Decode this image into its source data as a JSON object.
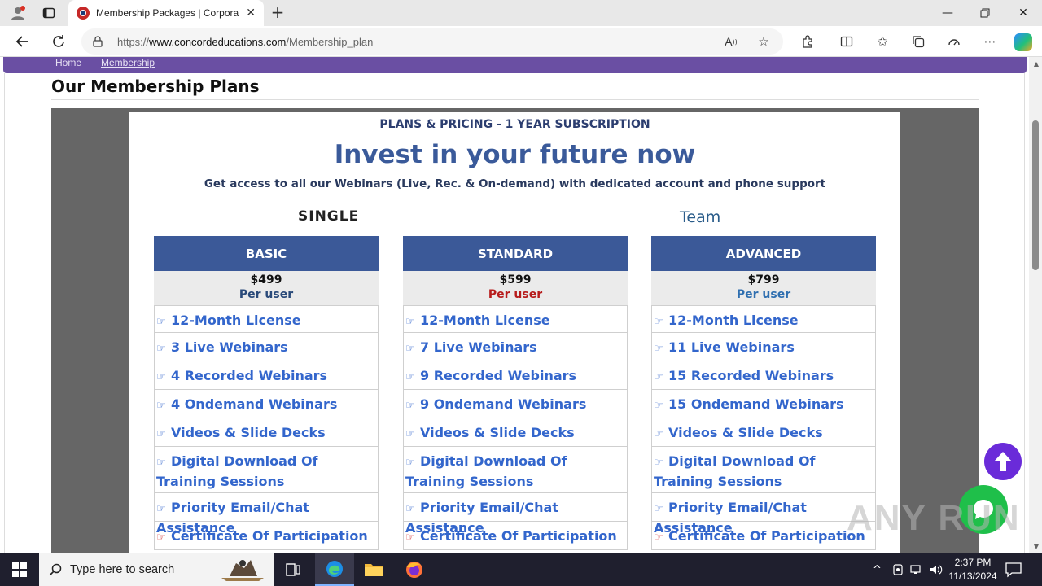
{
  "browser": {
    "tab_title": "Membership Packages | Corporat",
    "url_prefix": "https://",
    "url_domain": "www.concordeducations.com",
    "url_path": "/Membership_plan"
  },
  "breadcrumb": {
    "home": "Home",
    "current": "Membership"
  },
  "page": {
    "heading": "Our Membership Plans",
    "kicker": "PLANS & PRICING - 1 YEAR SUBSCRIPTION",
    "title": "Invest in your future now",
    "subtitle": "Get access to all our Webinars (Live, Rec. & On-demand) with dedicated account and phone support",
    "group_single": "SINGLE",
    "group_team": "Team"
  },
  "plans": [
    {
      "name": "BASIC",
      "price": "$499",
      "per": "Per user",
      "per_color": "#2a4a7a",
      "features": [
        "12-Month License",
        "3 Live Webinars",
        "4 Recorded Webinars",
        "4 Ondemand Webinars",
        "Videos & Slide Decks",
        "Digital Download Of Training Sessions",
        "Priority Email/Chat Assistance",
        "Certificate Of Participation"
      ]
    },
    {
      "name": "STANDARD",
      "price": "$599",
      "per": "Per user",
      "per_color": "#b71c1c",
      "features": [
        "12-Month License",
        "7 Live Webinars",
        "9 Recorded Webinars",
        "9 Ondemand Webinars",
        "Videos & Slide Decks",
        "Digital Download Of Training Sessions",
        "Priority Email/Chat Assistance",
        "Certificate Of Participation"
      ]
    },
    {
      "name": "ADVANCED",
      "price": "$799",
      "per": "Per user",
      "per_color": "#2f6fb0",
      "features": [
        "12-Month License",
        "11 Live Webinars",
        "15 Recorded Webinars",
        "15 Ondemand Webinars",
        "Videos & Slide Decks",
        "Digital Download Of Training Sessions",
        "Priority Email/Chat Assistance",
        "Certificate Of Participation"
      ]
    }
  ],
  "watermark": "ANY RUN",
  "taskbar": {
    "search_placeholder": "Type here to search",
    "time": "2:37 PM",
    "date": "11/13/2024"
  },
  "colors": {
    "accent_purple": "#6a4fa3",
    "plan_header": "#3b5998",
    "feature_text": "#3366cc"
  }
}
